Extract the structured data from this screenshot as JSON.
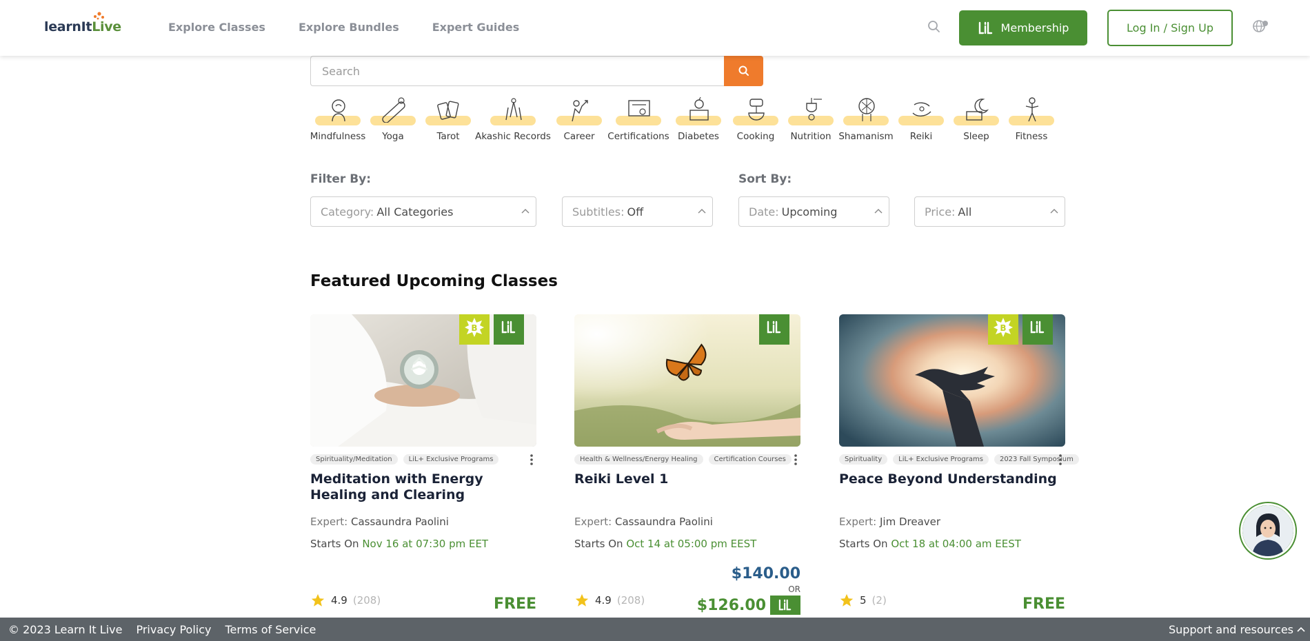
{
  "header": {
    "logo": "LearnItLive",
    "nav": [
      "Explore Classes",
      "Explore Bundles",
      "Expert Guides"
    ],
    "membership_label": "Membership",
    "login_label": "Log In / Sign Up"
  },
  "search": {
    "placeholder": "Search"
  },
  "categories": [
    "Mindfulness",
    "Yoga",
    "Tarot",
    "Akashic Records",
    "Career",
    "Certifications",
    "Diabetes",
    "Cooking",
    "Nutrition",
    "Shamanism",
    "Reiki",
    "Sleep",
    "Fitness"
  ],
  "filter": {
    "label": "Filter By:",
    "category_prefix": "Category:",
    "category_value": "All Categories",
    "subtitles_prefix": "Subtitles:",
    "subtitles_value": "Off"
  },
  "sort": {
    "label": "Sort By:",
    "date_prefix": "Date:",
    "date_value": "Upcoming",
    "price_prefix": "Price:",
    "price_value": "All"
  },
  "featured": {
    "title": "Featured Upcoming Classes",
    "cards": [
      {
        "tags": [
          "Spirituality/Meditation",
          "LiL+ Exclusive Programs"
        ],
        "title": "Meditation with Energy Healing and Clearing",
        "expert_label": "Expert:",
        "expert": "Cassaundra Paolini",
        "starts_label": "Starts On",
        "starts": "Nov 16 at 07:30 pm EET",
        "rating": "4.9",
        "reviews": "(208)",
        "price": "FREE"
      },
      {
        "tags": [
          "Health & Wellness/Energy Healing",
          "Certification Courses"
        ],
        "title": "Reiki Level 1",
        "expert_label": "Expert:",
        "expert": "Cassaundra Paolini",
        "starts_label": "Starts On",
        "starts": "Oct 14 at 05:00 pm EEST",
        "rating": "4.9",
        "reviews": "(208)",
        "price": "$140.00",
        "or": "OR",
        "member_price": "$126.00"
      },
      {
        "tags": [
          "Spirituality",
          "LiL+ Exclusive Programs",
          "2023 Fall Symposium"
        ],
        "title": "Peace Beyond Understanding",
        "expert_label": "Expert:",
        "expert": "Jim Dreaver",
        "starts_label": "Starts On",
        "starts": "Oct 18 at 04:00 am EEST",
        "rating": "5",
        "reviews": "(2)",
        "price": "FREE"
      }
    ]
  },
  "footer": {
    "copyright": "© 2023 Learn It Live",
    "privacy": "Privacy Policy",
    "terms": "Terms of Service",
    "support": "Support and resources"
  },
  "colors": {
    "brand_green": "#4a8f33",
    "accent_orange": "#ef7b2c",
    "badge_lime": "#c3d424",
    "footer": "#5d6368"
  }
}
